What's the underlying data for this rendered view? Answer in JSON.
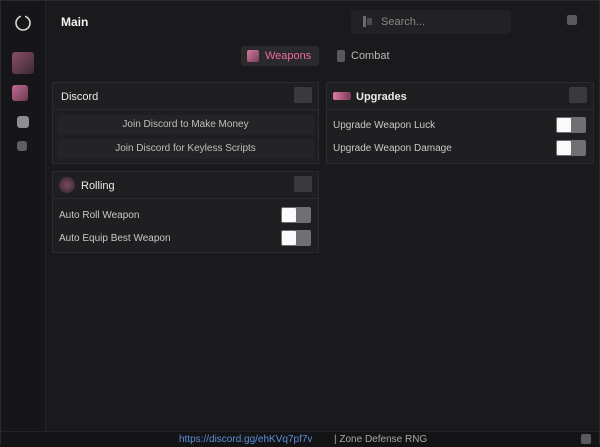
{
  "header": {
    "title": "Main"
  },
  "search": {
    "placeholder": "Search..."
  },
  "tabs": [
    {
      "label": "Weapons",
      "active": true
    },
    {
      "label": "Combat",
      "active": false
    }
  ],
  "discord_panel": {
    "title": "Discord",
    "buttons": [
      "Join Discord to Make Money",
      "Join Discord for Keyless Scripts"
    ]
  },
  "upgrades_panel": {
    "title": "Upgrades",
    "toggles": [
      {
        "label": "Upgrade Weapon Luck",
        "on": false
      },
      {
        "label": "Upgrade Weapon Damage",
        "on": false
      }
    ]
  },
  "rolling_panel": {
    "title": "Rolling",
    "toggles": [
      {
        "label": "Auto Roll Weapon",
        "on": false
      },
      {
        "label": "Auto Equip Best Weapon",
        "on": false
      }
    ]
  },
  "status": {
    "link": "https://discord.gg/ehKVq7pf7v",
    "game": "| Zone Defense RNG"
  },
  "colors": {
    "accent": "#e86aa0",
    "link": "#5b8fd6",
    "background": "#1a1a1c",
    "panel": "#1f1f21"
  }
}
